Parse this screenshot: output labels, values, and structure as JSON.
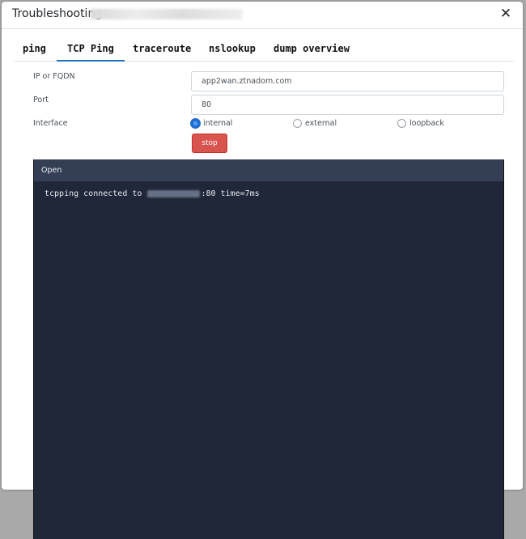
{
  "modal": {
    "title": "Troubleshooting:",
    "close_icon": "close-icon"
  },
  "tabs": [
    {
      "label": "ping",
      "active": false
    },
    {
      "label": "TCP Ping",
      "active": true
    },
    {
      "label": "traceroute",
      "active": false
    },
    {
      "label": "nslookup",
      "active": false
    },
    {
      "label": "dump overview",
      "active": false
    }
  ],
  "form": {
    "host_label": "IP or FQDN",
    "host_value": "app2wan.ztnadom.com",
    "port_label": "Port",
    "port_value": "80",
    "interface_label": "Interface",
    "interface_options": [
      {
        "label": "internal",
        "checked": true
      },
      {
        "label": "external",
        "checked": false
      },
      {
        "label": "loopback",
        "checked": false
      }
    ],
    "stop_label": "stop"
  },
  "terminal": {
    "status": "Open",
    "line_prefix": "tcpping connected to ",
    "line_suffix": ":80 time=7ms"
  },
  "colors": {
    "accent": "#1f6fbf",
    "stop": "#d9534f",
    "terminal_bg": "#1f2738",
    "terminal_header": "#343f55"
  }
}
